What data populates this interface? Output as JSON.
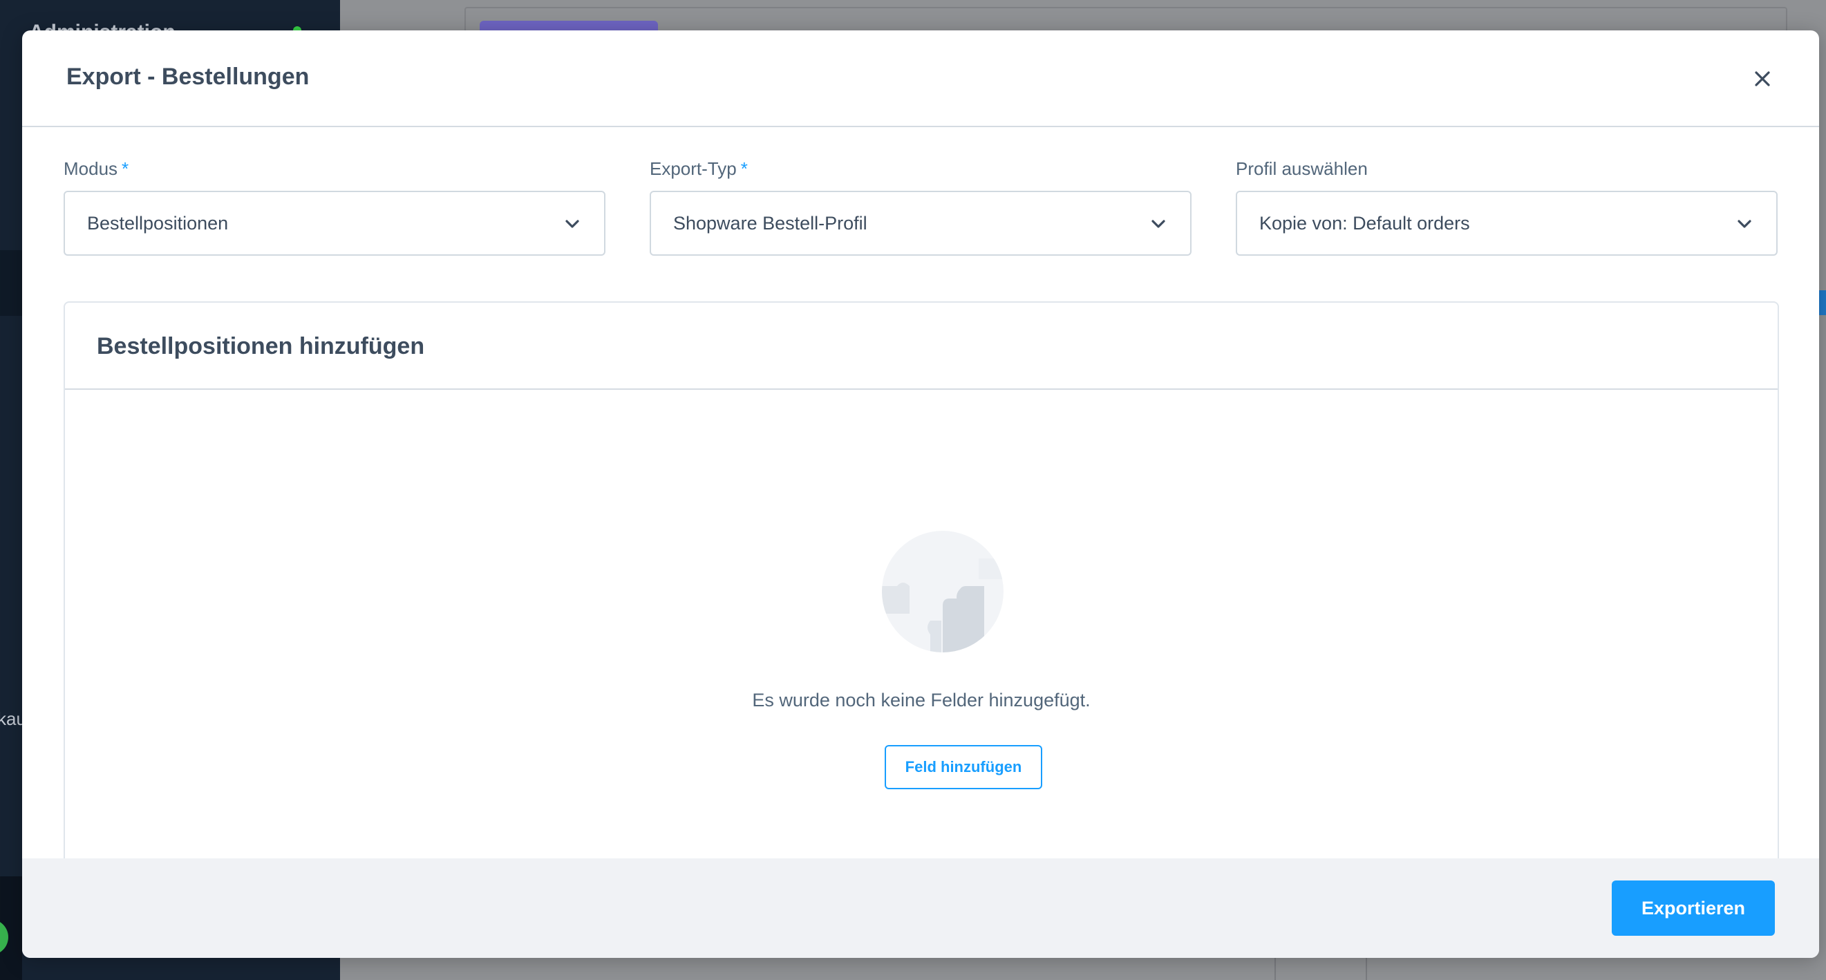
{
  "background": {
    "admin_title": "Administration",
    "sidebar_fragment": "kau",
    "status_color": "#37d046",
    "accent_purple": "#6d64c2"
  },
  "modal": {
    "title": "Export - Bestellungen",
    "close_icon": "close-icon",
    "fields": [
      {
        "label": "Modus",
        "required": "*",
        "value": "Bestellpositionen"
      },
      {
        "label": "Export-Typ",
        "required": "*",
        "value": "Shopware Bestell-Profil"
      },
      {
        "label": "Profil auswählen",
        "required": "",
        "value": "Kopie von: Default orders"
      }
    ],
    "card": {
      "title": "Bestellpositionen hinzufügen",
      "empty_text": "Es wurde noch keine Felder hinzugefügt.",
      "add_button": "Feld hinzufügen"
    },
    "footer": {
      "export_button": "Exportieren"
    }
  },
  "colors": {
    "primary": "#189eff",
    "text": "#3d4c5e",
    "footer_bg": "#f0f2f5"
  }
}
